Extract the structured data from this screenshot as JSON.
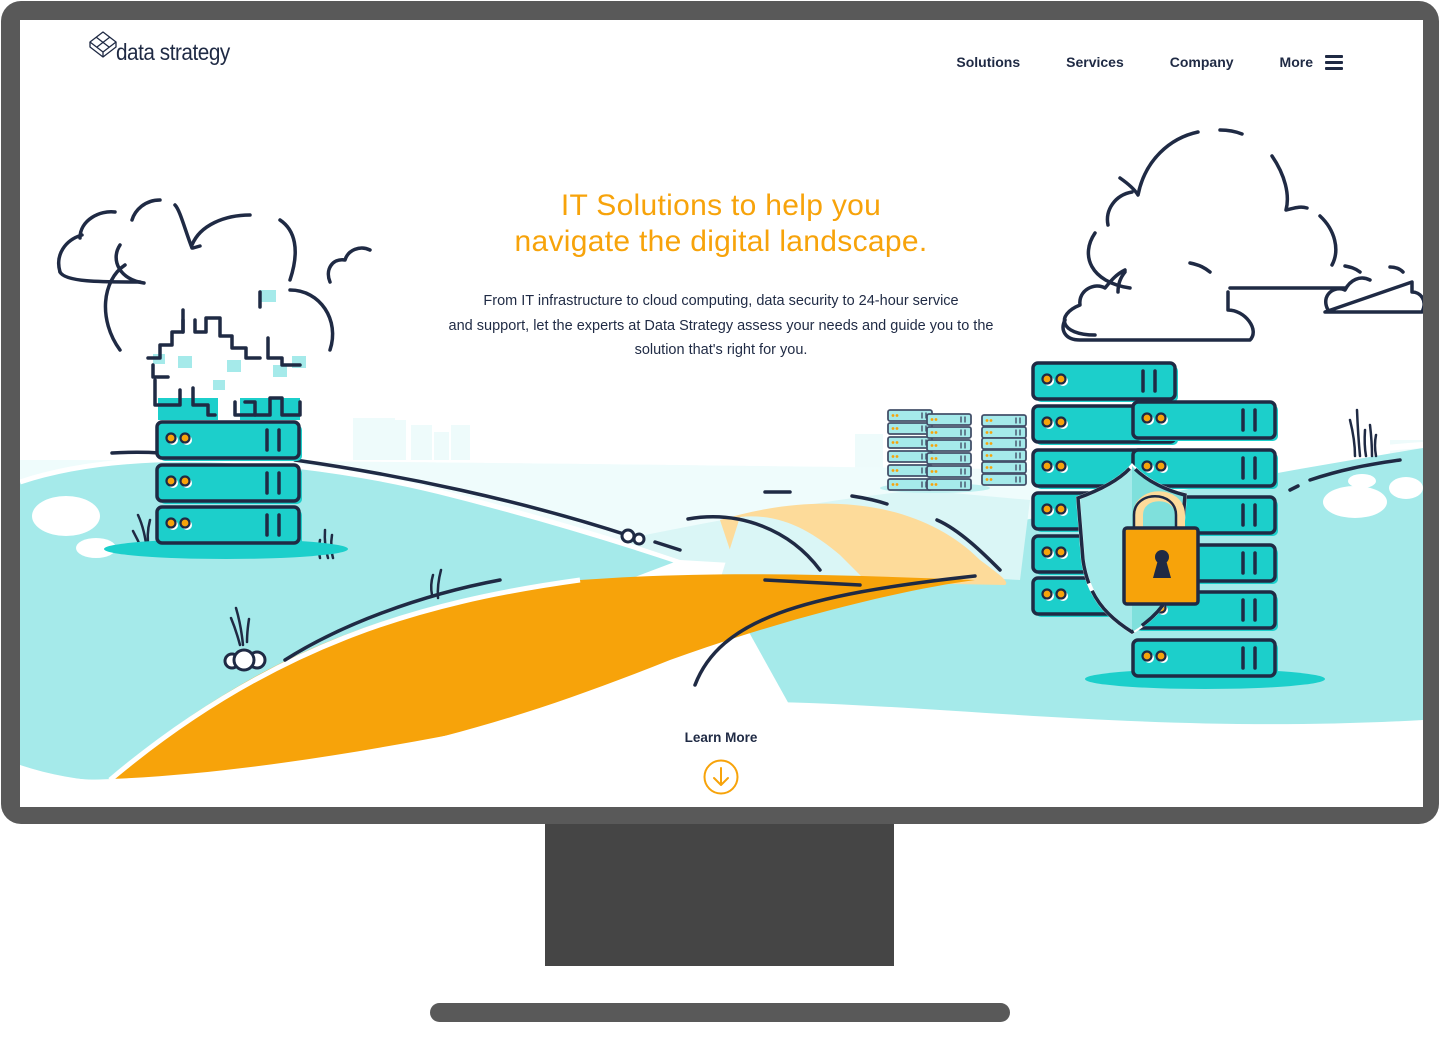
{
  "brand": {
    "name": "data strategy",
    "logo_icon": "cube-icon"
  },
  "nav": {
    "items": [
      {
        "label": "Solutions"
      },
      {
        "label": "Services"
      },
      {
        "label": "Company"
      }
    ],
    "more_label": "More",
    "menu_icon": "hamburger-icon"
  },
  "hero": {
    "title_line1": "IT Solutions to help you",
    "title_line2": "navigate the digital landscape.",
    "body_line1": "From IT infrastructure to cloud computing, data security to 24-hour service",
    "body_line2": "and support, let the experts at Data Strategy assess your needs and guide you to the",
    "body_line3": "solution that's right for you."
  },
  "cta": {
    "label": "Learn More",
    "icon": "arrow-down-circle-icon"
  },
  "illustration": {
    "subjects": [
      "cloud-servers",
      "server-racks",
      "security-shield",
      "padlock",
      "winding-road",
      "hills"
    ]
  },
  "colors": {
    "accent_orange": "#f7a30a",
    "navy": "#1f2a44",
    "teal": "#1ccfcb",
    "light_teal": "#a5eaea",
    "sand": "#fddb9a",
    "monitor_frame": "#595959",
    "monitor_stand": "#454545"
  }
}
